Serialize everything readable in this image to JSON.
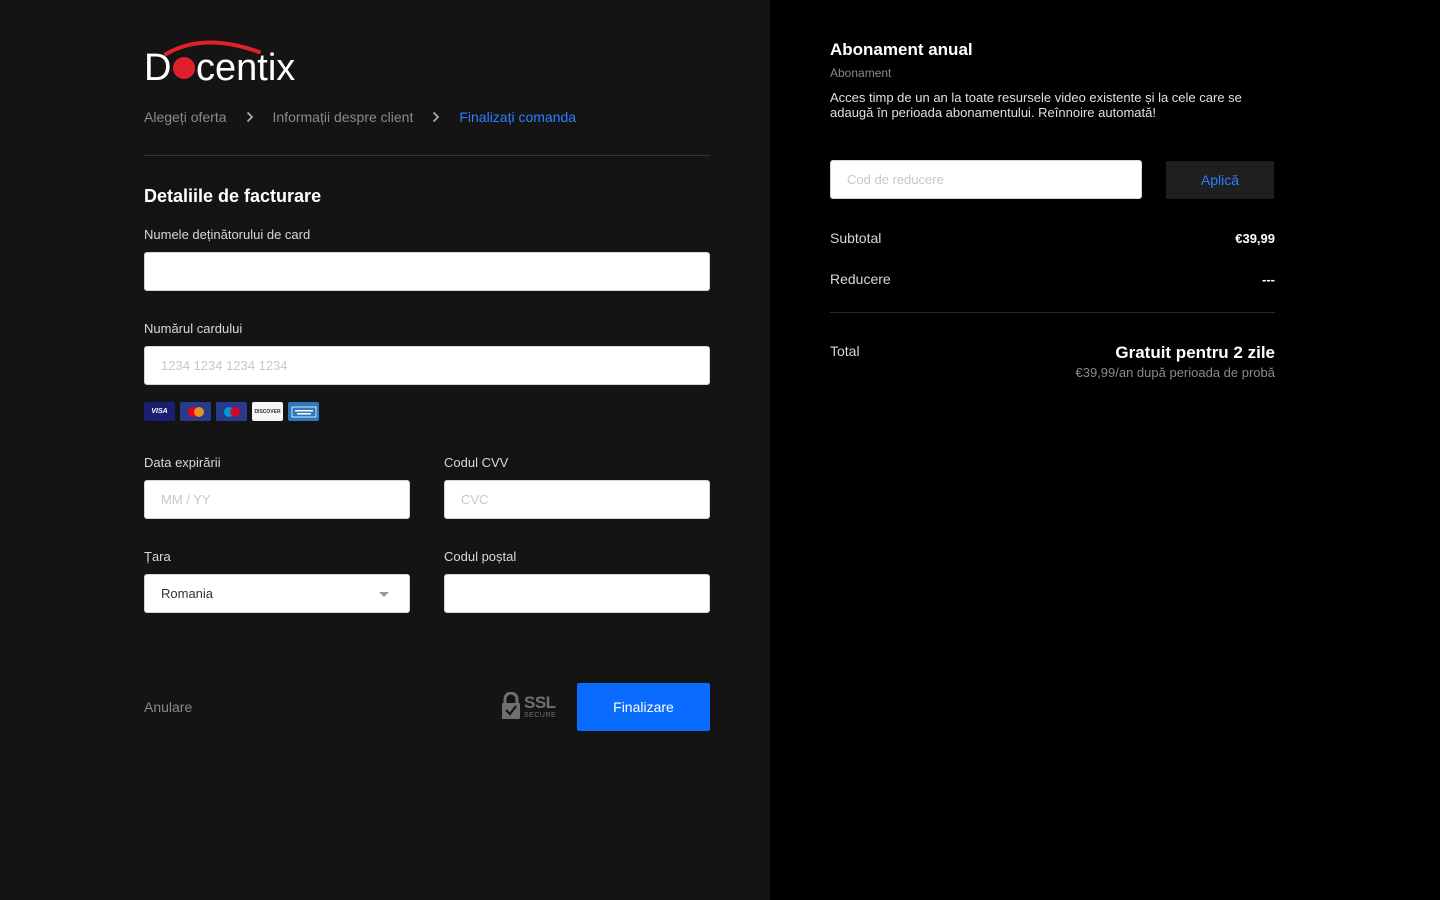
{
  "brand": {
    "logo_text": "Docentix",
    "accent_color": "#e0212c"
  },
  "breadcrumb": {
    "steps": [
      {
        "label": "Alegeți oferta"
      },
      {
        "label": "Informații despre client"
      },
      {
        "label": "Finalizați comanda",
        "active": true
      }
    ]
  },
  "billing": {
    "title": "Detaliile de facturare",
    "cardholder_label": "Numele deținătorului de card",
    "cardholder_value": "",
    "card_number_label": "Numărul cardului",
    "card_number_placeholder": "1234 1234 1234 1234",
    "card_brands": [
      "VISA",
      "Mastercard",
      "Maestro",
      "DISCOVER",
      "AMERICAN EXPRESS"
    ],
    "expiry_label": "Data expirării",
    "expiry_placeholder": "MM / YY",
    "cvv_label": "Codul CVV",
    "cvv_placeholder": "CVC",
    "country_label": "Țara",
    "country_value": "Romania",
    "postal_label": "Codul poștal",
    "postal_value": ""
  },
  "actions": {
    "cancel_label": "Anulare",
    "ssl_label": "SSL",
    "ssl_sub": "SECURE",
    "submit_label": "Finalizare",
    "submit_color": "#0a6cff"
  },
  "summary": {
    "plan_title": "Abonament anual",
    "plan_type": "Abonament",
    "plan_description": "Acces timp de un an la toate resursele video existente și la cele care se adaugă în perioada abonamentului. Reînnoire automată!",
    "coupon_placeholder": "Cod de reducere",
    "apply_label": "Aplică",
    "subtotal_label": "Subtotal",
    "subtotal_value": "€39,99",
    "discount_label": "Reducere",
    "discount_value": "---",
    "total_label": "Total",
    "total_value": "Gratuit pentru 2 zile",
    "total_note": "€39,99/an după perioada de probă"
  }
}
